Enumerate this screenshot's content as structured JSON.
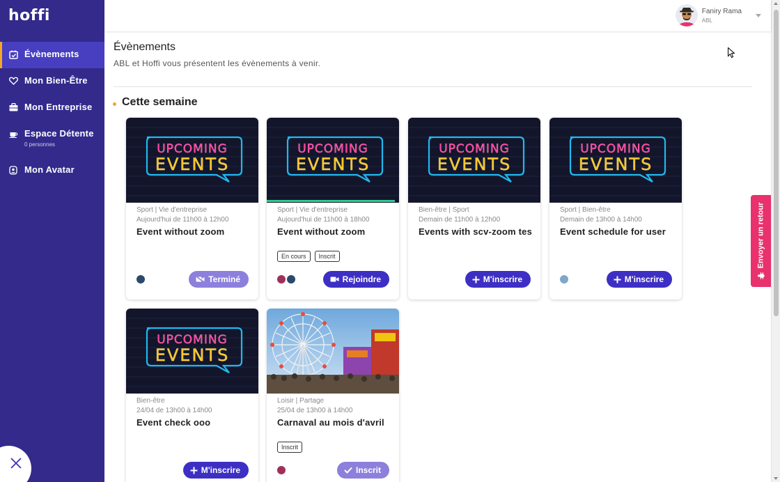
{
  "app": {
    "logo": "hoffi"
  },
  "sidebar": {
    "items": [
      {
        "label": "Évènements",
        "sub": "",
        "icon": "calendar-check-icon",
        "active": true
      },
      {
        "label": "Mon Bien-Être",
        "sub": "",
        "icon": "heart-icon"
      },
      {
        "label": "Mon Entreprise",
        "sub": "",
        "icon": "briefcase-icon"
      },
      {
        "label": "Espace Détente",
        "sub": "0 personnes",
        "icon": "coffee-icon"
      },
      {
        "label": "Mon Avatar",
        "sub": "",
        "icon": "avatar-icon"
      }
    ]
  },
  "user": {
    "name": "Faniry Rama",
    "org": "ABL"
  },
  "page": {
    "title": "Évènements",
    "subtitle": "ABL et Hoffi vous présentent les évènements à venir.",
    "section_title": "Cette semaine"
  },
  "events": [
    {
      "category": "Sport | Vie d'entreprise",
      "time": "Aujourd'hui de 11h00 à 12h00",
      "name": "Event without zoom",
      "badges": [],
      "button": "Terminé",
      "image": "upcoming-events-neon"
    },
    {
      "category": "Sport | Vie d'entreprise",
      "time": "Aujourd'hui de 11h00 à 18h00",
      "name": "Event without zoom",
      "badges": [
        "En cours",
        "Inscrit"
      ],
      "button": "Rejoindre",
      "image": "upcoming-events-neon",
      "progress": 0.97
    },
    {
      "category": "Bien-être | Sport",
      "time": "Demain de 11h00 à 12h00",
      "name": "Events with scv-zoom tes",
      "badges": [],
      "button": "M'inscrire",
      "image": "upcoming-events-neon"
    },
    {
      "category": "Sport | Bien-être",
      "time": "Demain de 13h00 à 14h00",
      "name": "Event schedule for user",
      "badges": [],
      "button": "M'inscrire",
      "image": "upcoming-events-neon"
    },
    {
      "category": "Bien-être",
      "time": "24/04 de 13h00 à 14h00",
      "name": "Event check ooo",
      "badges": [],
      "button": "M'inscrire",
      "image": "upcoming-events-neon"
    },
    {
      "category": "Loisir | Partage",
      "time": "25/04 de 13h00 à 14h00",
      "name": "Carnaval au mois d'avril",
      "badges": [
        "Inscrit"
      ],
      "button": "Inscrit",
      "image": "carnival-ferris-wheel"
    }
  ],
  "neon_sign": {
    "line1": "UPCOMING",
    "line2": "EVENTS"
  },
  "feedback": {
    "label": "Envoyer un retour"
  },
  "colors": {
    "sidebar": "#332a8c",
    "accent": "#3e2fc4",
    "highlight": "#f5a623",
    "feedback": "#e8316d"
  }
}
